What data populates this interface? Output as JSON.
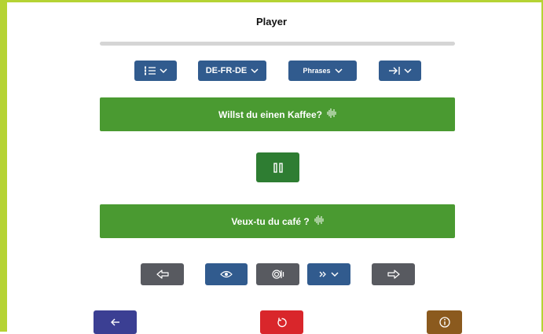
{
  "header": {
    "title": "Player"
  },
  "progress": {
    "fraction": 0.0
  },
  "toolbar": {
    "list_label": "",
    "language_label": "DE-FR-DE",
    "mode_label": "Phrases",
    "skip_label": ""
  },
  "phrases": {
    "source_text": "Willst du einen Kaffee?",
    "target_text": "Veux-tu du café ?"
  },
  "colors": {
    "frame": "#b5d334",
    "phrase_bg": "#4a9a31",
    "toolbar_blue": "#315b8e",
    "control_gray": "#585a60",
    "pause_green": "#2e7d32",
    "back_navy": "#3b3f93",
    "reset_red": "#d9262b",
    "info_brown": "#8b5a1e"
  },
  "icons": {
    "list": "numbered-list-icon",
    "skip": "skip-to-end-icon",
    "audio": "audio-waveform-icon",
    "pause": "pause-icon",
    "prev": "arrow-left-outline-icon",
    "show": "eye-icon",
    "replay": "replay-audio-icon",
    "speed": "fast-forward-icon",
    "next": "arrow-right-outline-icon",
    "back": "arrow-left-icon",
    "reset": "reset-icon",
    "info": "info-icon"
  }
}
